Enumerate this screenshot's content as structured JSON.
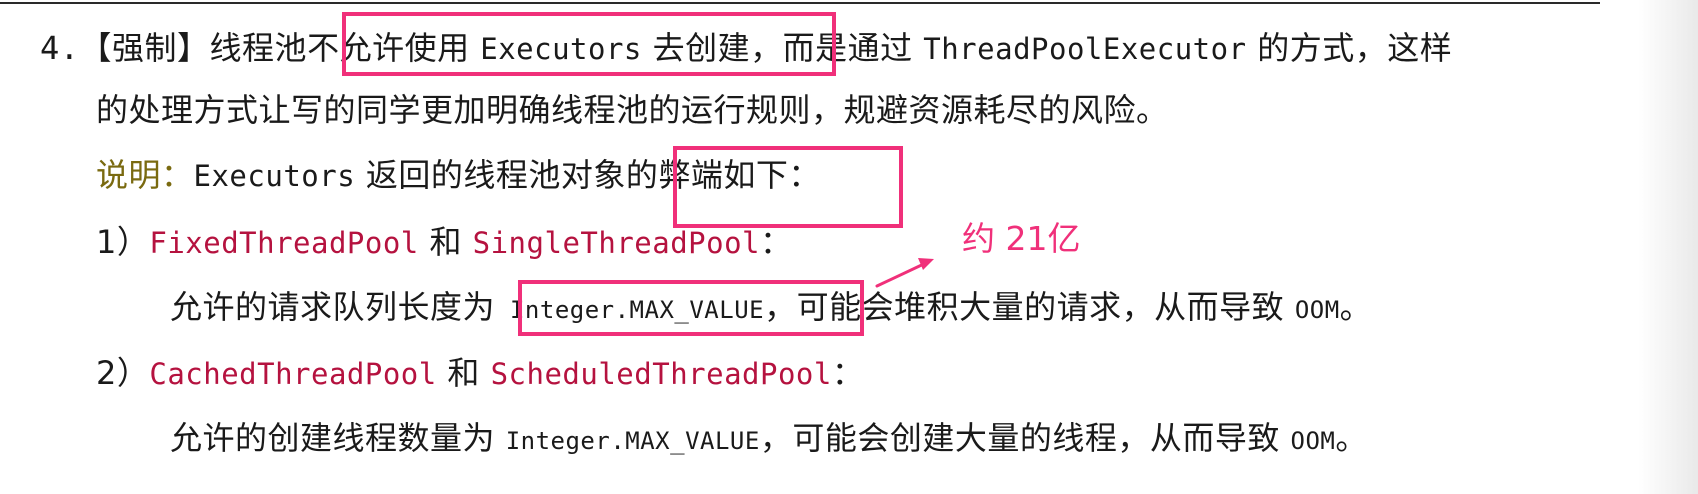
{
  "rule": {
    "number": "4.",
    "tag": "【强制】",
    "text_a": "线程池",
    "text_b": "不允许使用 ",
    "executors": "Executors",
    "text_c": " 去创建",
    "text_d": "，而是通过 ",
    "tpe": "ThreadPoolExecutor",
    "text_e": " 的方式，这样",
    "line2": "的处理方式让写的同学更加明确线程池的运行规则，规避资源耗尽的风险。"
  },
  "note": {
    "label": "说明：",
    "executors": "Executors",
    "text_a": " 返回的线程池对象",
    "text_b": "的弊端如下："
  },
  "items": [
    {
      "number": "1）",
      "pool_a": "FixedThreadPool",
      "joiner": " 和 ",
      "pool_b": "SingleThreadPool",
      "colon": "：",
      "detail_a": "允许的请求队列长度为",
      "detail_code": " Integer.MAX_VALUE",
      "detail_comma": "，",
      "detail_b": "可能会堆积大量的请求，从而导致 ",
      "detail_oom": "OOM",
      "detail_end": "。"
    },
    {
      "number": "2）",
      "pool_a": "CachedThreadPool",
      "joiner": " 和 ",
      "pool_b": "ScheduledThreadPool",
      "colon": "：",
      "detail_a": "允许的创建线程数量为 ",
      "detail_code": "Integer.MAX_VALUE",
      "detail_comma": "，",
      "detail_b": "可能会创建大量的线程，从而导致 ",
      "detail_oom": "OOM",
      "detail_end": "。"
    }
  ],
  "annotation": {
    "text": "约 21亿"
  },
  "colors": {
    "highlight": "#f0307a",
    "code_red": "#b5123f",
    "note_label": "#7a6a10"
  }
}
